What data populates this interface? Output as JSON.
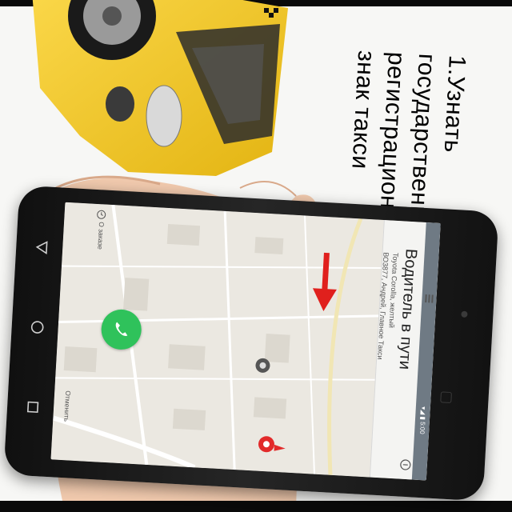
{
  "headline": {
    "lines": [
      "1.Узнать",
      "государственный",
      "регистрационный",
      "знак такси"
    ]
  },
  "screen": {
    "order_link": "О заказе",
    "cancel_link": "Отменить",
    "driver_title": "Водитель в пути",
    "driver_car": "Toyota Corolla, желтый",
    "driver_details": "ВО3877, Андрей, Главное Такси",
    "status_icons": "▾◢ ▮ 5:00"
  },
  "colors": {
    "taxi_yellow": "#f3c726",
    "call_green": "#2fc25b",
    "arrow_red": "#e0201d",
    "pin_red": "#e22a2a"
  },
  "icons": {
    "back": "triangle-back-icon",
    "home": "circle-home-icon",
    "recents": "square-recents-icon",
    "call": "phone-icon",
    "menu": "hamburger-menu-icon",
    "pin": "map-pin-icon"
  }
}
